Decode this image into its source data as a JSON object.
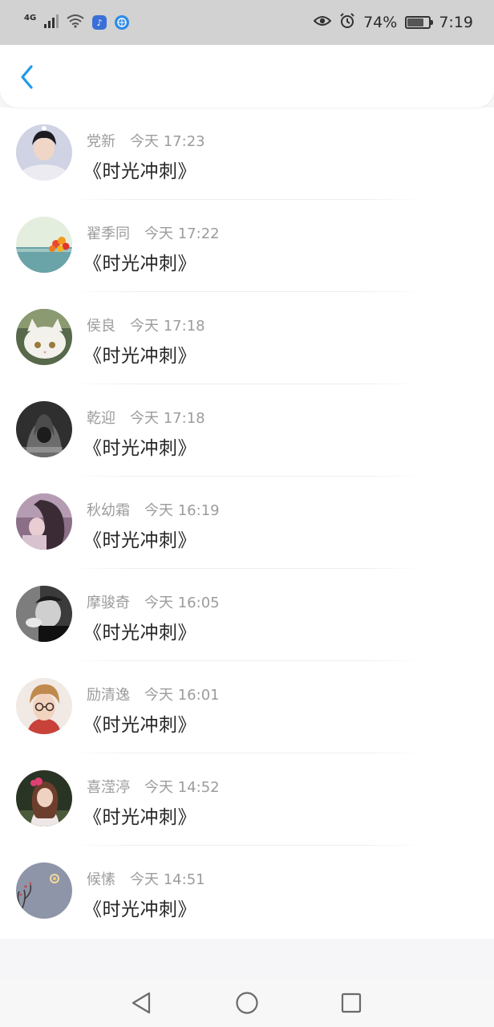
{
  "status_bar": {
    "network": "4G",
    "battery": "74%",
    "battery_level": 0.74,
    "time": "7:19",
    "icons": [
      "signal-icon",
      "wifi-icon",
      "music-app-icon",
      "browser-app-icon",
      "eye-icon",
      "alarm-icon",
      "battery-icon"
    ]
  },
  "header": {
    "back_icon": "chevron-left-icon",
    "accent_color": "#1e9bea"
  },
  "messages": [
    {
      "name": "党新",
      "time": "今天 17:23",
      "text": "《时光冲刺》"
    },
    {
      "name": "翟季同",
      "time": "今天 17:22",
      "text": "《时光冲刺》"
    },
    {
      "name": "侯良",
      "time": "今天 17:18",
      "text": "《时光冲刺》"
    },
    {
      "name": "乾迎",
      "time": "今天 17:18",
      "text": "《时光冲刺》"
    },
    {
      "name": "秋幼霜",
      "time": "今天 16:19",
      "text": "《时光冲刺》"
    },
    {
      "name": "摩骏奇",
      "time": "今天 16:05",
      "text": "《时光冲刺》"
    },
    {
      "name": "励清逸",
      "time": "今天 16:01",
      "text": "《时光冲刺》"
    },
    {
      "name": "喜滢渟",
      "time": "今天 14:52",
      "text": "《时光冲刺》"
    },
    {
      "name": "候愫",
      "time": "今天 14:51",
      "text": "《时光冲刺》"
    }
  ],
  "nav_bar": {
    "icons": [
      "back-triangle-icon",
      "home-circle-icon",
      "recents-square-icon"
    ]
  }
}
